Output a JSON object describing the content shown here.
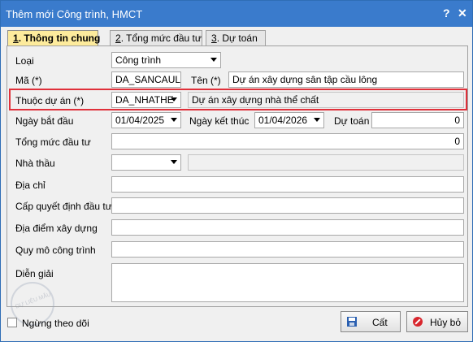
{
  "window": {
    "title": "Thêm mới Công trình, HMCT",
    "help": "?",
    "close": "✕"
  },
  "tabs": [
    {
      "num": "1",
      "label": ". Thông tin chung"
    },
    {
      "num": "2",
      "label": ". Tổng mức đầu tư"
    },
    {
      "num": "3",
      "label": ". Dự toán"
    }
  ],
  "form": {
    "loai": {
      "label": "Loại",
      "value": "Công trình"
    },
    "ma": {
      "label": "Mã (*)",
      "value": "DA_SANCAUL"
    },
    "ten": {
      "label": "Tên (*)",
      "value": "Dự án xây dựng sân tập cầu lông"
    },
    "thuoc_du_an": {
      "label": "Thuộc dự án (*)",
      "value": "DA_NHATHE",
      "name": "Dự án xây dựng nhà thể chất"
    },
    "ngay_bat_dau": {
      "label": "Ngày bắt đầu",
      "value": "01/04/2025"
    },
    "ngay_ket_thuc": {
      "label": "Ngày kết thúc",
      "value": "01/04/2026"
    },
    "du_toan": {
      "label": "Dự toán",
      "value": "0"
    },
    "tong_muc_dau_tu": {
      "label": "Tổng mức đầu tư",
      "value": "0"
    },
    "nha_thau": {
      "label": "Nhà thầu",
      "value": "",
      "name": ""
    },
    "dia_chi": {
      "label": "Địa chỉ",
      "value": ""
    },
    "cap_quyet_dinh": {
      "label": "Cấp quyết định đầu tư",
      "value": ""
    },
    "dia_diem": {
      "label": "Địa điểm xây dựng",
      "value": ""
    },
    "quy_mo": {
      "label": "Quy mô công trình",
      "value": ""
    },
    "dien_giai": {
      "label": "Diễn giải",
      "value": ""
    }
  },
  "footer": {
    "ngung_theo_doi": "Ngừng theo dõi",
    "save": "Cất",
    "cancel": "Hủy bỏ"
  },
  "stamp_text": "DỰ LIỆU MẪU",
  "colors": {
    "titlebar": "#3a7bcc",
    "active_tab": "#fdeb9c",
    "highlight": "#e0303a"
  }
}
